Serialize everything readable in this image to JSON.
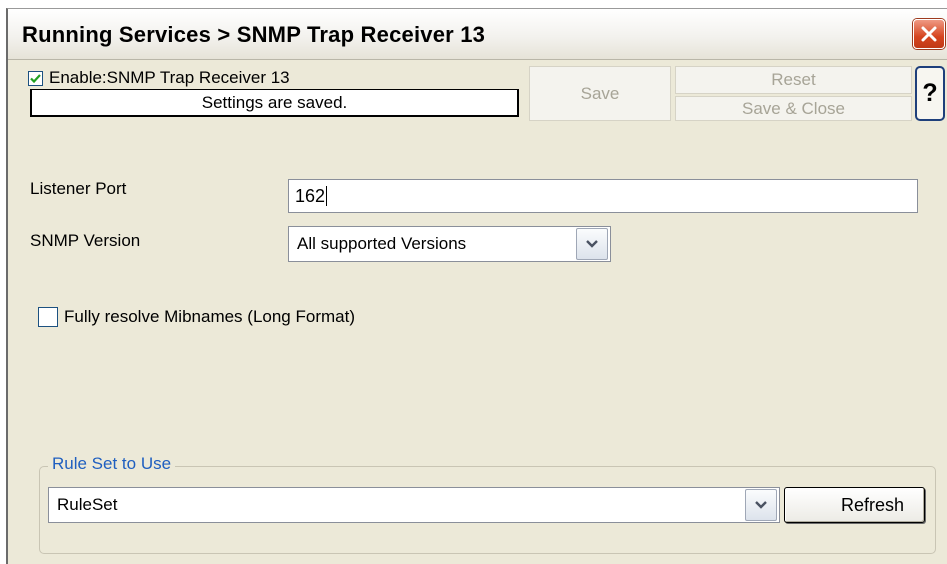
{
  "window": {
    "title": "Running Services > SNMP Trap Receiver 13"
  },
  "toolbar": {
    "enable_label": "Enable:SNMP Trap Receiver 13",
    "enable_checked": true,
    "status_text": "Settings are saved.",
    "save_label": "Save",
    "reset_label": "Reset",
    "save_close_label": "Save & Close",
    "help_label": "?"
  },
  "form": {
    "listener_port_label": "Listener Port",
    "listener_port_value": "162",
    "snmp_version_label": "SNMP Version",
    "snmp_version_value": "All supported Versions",
    "resolve_mibnames_label": "Fully resolve Mibnames (Long Format)",
    "resolve_mibnames_checked": false
  },
  "ruleset": {
    "legend": "Rule Set to Use",
    "value": "RuleSet",
    "refresh_label": "Refresh"
  },
  "icons": [
    "close-icon",
    "checkmark-icon",
    "chevron-down-icon",
    "help-icon"
  ],
  "colors": {
    "window_bg": "#ece9d8",
    "close_red": "#d6451f",
    "legend_blue": "#1f5fc0",
    "checkbox_border": "#1c5180",
    "check_green": "#21a121"
  }
}
